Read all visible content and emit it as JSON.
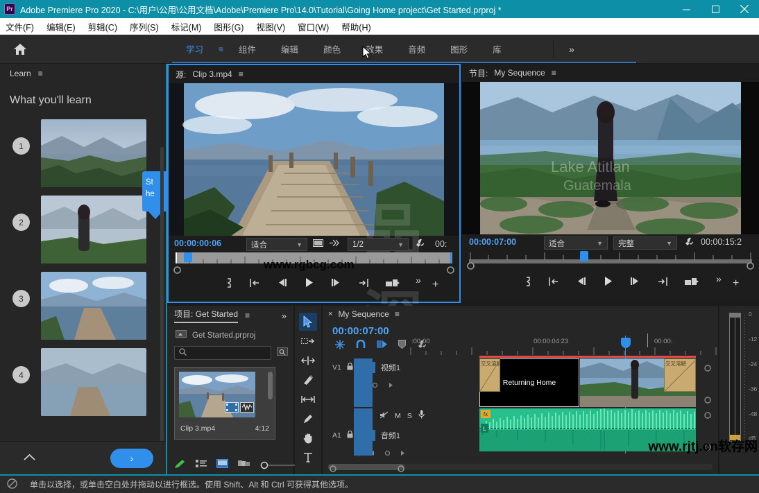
{
  "titlebar": {
    "app_icon": "pr-logo",
    "title": "Adobe Premiere Pro 2020 - C:\\用户\\公用\\公用文档\\Adobe\\Premiere Pro\\14.0\\Tutorial\\Going Home project\\Get Started.prproj *",
    "minimize": "minimize-icon",
    "maximize": "maximize-icon",
    "close": "close-icon",
    "accent_color": "#0e8fa8"
  },
  "menubar": {
    "items": [
      {
        "label": "文件(F)"
      },
      {
        "label": "编辑(E)"
      },
      {
        "label": "剪辑(C)"
      },
      {
        "label": "序列(S)"
      },
      {
        "label": "标记(M)"
      },
      {
        "label": "图形(G)"
      },
      {
        "label": "视图(V)"
      },
      {
        "label": "窗口(W)"
      },
      {
        "label": "帮助(H)"
      }
    ]
  },
  "workspace": {
    "home_icon": "home-icon",
    "hamburger": "≡",
    "tabs": [
      {
        "label": "学习",
        "active": true
      },
      {
        "label": "组件",
        "active": false
      },
      {
        "label": "编辑",
        "active": false
      },
      {
        "label": "颜色",
        "active": false
      },
      {
        "label": "效果",
        "active": false
      },
      {
        "label": "音频",
        "active": false
      },
      {
        "label": "图形",
        "active": false
      },
      {
        "label": "库",
        "active": false
      }
    ],
    "overflow": "»",
    "active_color": "#3b8ee8"
  },
  "learn_panel": {
    "tab_label": "Learn",
    "menu_icon": "≡",
    "heading": "What you'll learn",
    "items": [
      {
        "number": "1"
      },
      {
        "number": "2"
      },
      {
        "number": "3"
      },
      {
        "number": "4"
      }
    ],
    "tooltip_line1": "St",
    "tooltip_line2": "he",
    "collapse_icon": "chevron-up-icon",
    "next_label": "›"
  },
  "source_monitor": {
    "tab_prefix": "源:",
    "clip_name": "Clip 3.mp4",
    "menu_icon": "≡",
    "timecode": "00:00:00:06",
    "fit_value": "适合",
    "resolution_value": "1/2",
    "end_timecode": "00:",
    "export_frame_icon": "export-frame-icon",
    "settings_icon": "wrench-icon",
    "buttons": [
      {
        "name": "marker-button",
        "glyph": "}"
      },
      {
        "name": "mark-in-button",
        "glyph": "{←"
      },
      {
        "name": "step-back-button",
        "glyph": "◀|"
      },
      {
        "name": "play-button",
        "glyph": "▶"
      },
      {
        "name": "step-forward-button",
        "glyph": "|▶"
      },
      {
        "name": "mark-out-button",
        "glyph": "→{"
      },
      {
        "name": "insert-button",
        "glyph": "insert-icon"
      },
      {
        "name": "more-button",
        "glyph": "»"
      },
      {
        "name": "add-button",
        "glyph": "+"
      }
    ]
  },
  "program_monitor": {
    "tab_prefix": "节目:",
    "sequence_name": "My Sequence",
    "menu_icon": "≡",
    "timecode": "00:00:07:00",
    "fit_value": "适合",
    "quality_value": "完整",
    "duration": "00:00:15:2",
    "settings_icon": "wrench-icon",
    "overlay_line1": "Lake Atitlan",
    "overlay_line2": "Guatemala",
    "buttons": [
      {
        "name": "marker-button",
        "glyph": "}"
      },
      {
        "name": "mark-in-button",
        "glyph": "{←"
      },
      {
        "name": "step-back-button",
        "glyph": "◀|"
      },
      {
        "name": "play-button",
        "glyph": "▶"
      },
      {
        "name": "step-forward-button",
        "glyph": "|▶"
      },
      {
        "name": "mark-out-button",
        "glyph": "→{"
      },
      {
        "name": "lift-button",
        "glyph": "lift-icon"
      },
      {
        "name": "more-button",
        "glyph": "»"
      },
      {
        "name": "add-button",
        "glyph": "+"
      }
    ]
  },
  "project_panel": {
    "tab_prefix": "项目:",
    "project_name": "Get Started",
    "menu_icon": "≡",
    "overflow": "»",
    "file_name": "Get Started.prproj",
    "search_placeholder": "",
    "search_value": "",
    "clip": {
      "name": "Clip 3.mp4",
      "duration": "4:12"
    },
    "footer_icons": [
      {
        "name": "new-item-pen-icon"
      },
      {
        "name": "list-view-icon"
      },
      {
        "name": "icon-view-icon",
        "active": true
      },
      {
        "name": "freeform-view-icon"
      },
      {
        "name": "zoom-slider"
      }
    ]
  },
  "tools": [
    {
      "name": "selection-tool",
      "active": true
    },
    {
      "name": "track-select-tool",
      "active": false
    },
    {
      "name": "ripple-edit-tool",
      "active": false
    },
    {
      "name": "razor-tool",
      "active": false
    },
    {
      "name": "slip-tool",
      "active": false
    },
    {
      "name": "pen-tool",
      "active": false
    },
    {
      "name": "hand-tool",
      "active": false
    },
    {
      "name": "type-tool",
      "active": false
    }
  ],
  "timeline": {
    "close_icon": "×",
    "sequence_name": "My Sequence",
    "menu_icon": "≡",
    "timecode": "00:00:07:00",
    "toolbar_icons": [
      {
        "name": "nest-toggle-icon",
        "active": true
      },
      {
        "name": "snap-icon",
        "active": true
      },
      {
        "name": "linked-selection-icon",
        "active": true
      },
      {
        "name": "marker-icon",
        "active": false
      },
      {
        "name": "timeline-settings-icon",
        "active": false
      }
    ],
    "ruler_labels": [
      ":00:00",
      "00:00:04:23",
      "00:00:"
    ],
    "tracks": [
      {
        "id": "V1",
        "label": "视频1",
        "type": "video",
        "lock_icon": "lock-icon",
        "toggle": "V1",
        "clips": [
          {
            "name": "交叉溶解",
            "type": "transition"
          },
          {
            "name": "Returning Home",
            "type": "title"
          },
          {
            "name": "交叉溶解",
            "type": "transition"
          }
        ]
      },
      {
        "id": "A1",
        "label": "音频1",
        "type": "audio",
        "lock_icon": "lock-icon",
        "toggle": "A1",
        "mute": "M",
        "solo": "S",
        "mic": "voice-icon",
        "fx_badge": "fx",
        "channel_badge": "L"
      }
    ]
  },
  "audio_meters": {
    "scale": [
      "0",
      "-12",
      "-24",
      "-36",
      "-48",
      "dB"
    ]
  },
  "statusbar": {
    "icon": "no-drop-icon",
    "message": "单击以选择，或单击空白处并拖动以进行框选。使用 Shift、Alt 和 Ctrl 可获得其他选项。"
  },
  "watermarks": {
    "bottom_right": "www.rjtj.cn软存网",
    "monitor": "www.rgbcg.com"
  }
}
